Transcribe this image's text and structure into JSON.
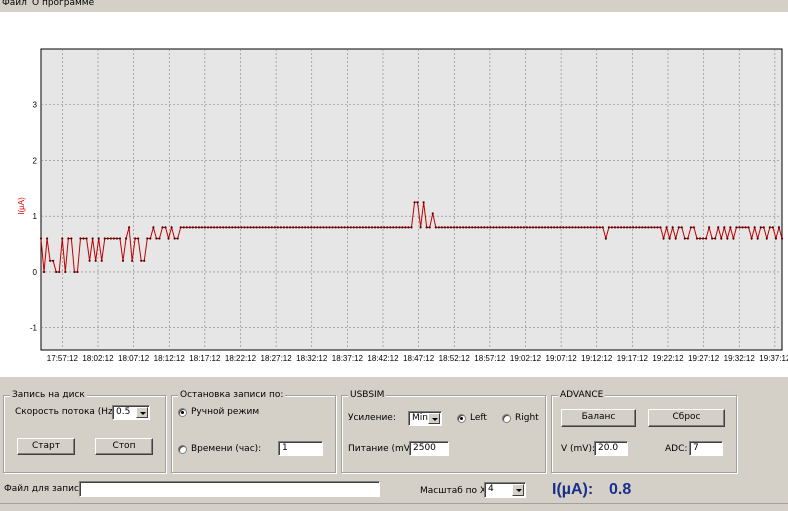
{
  "menu": {
    "file": "Файл",
    "about": "О программе"
  },
  "colors": {
    "trace": "#c00000",
    "marker": "#600000",
    "ylabel": "#e00000",
    "grid": "#808080",
    "readout": "#1a2f8c"
  },
  "chart_data": {
    "type": "line",
    "ylabel": "I(µA)",
    "ylim": [
      -1.4,
      4.0
    ],
    "yticks": [
      -1,
      0,
      1,
      2,
      3
    ],
    "xticks": [
      "17:57:12",
      "18:02:12",
      "18:07:12",
      "18:12:12",
      "18:17:12",
      "18:22:12",
      "18:27:12",
      "18:32:12",
      "18:37:12",
      "18:42:12",
      "18:47:12",
      "18:52:12",
      "18:57:12",
      "19:02:12",
      "19:07:12",
      "19:12:12",
      "19:17:12",
      "19:22:12",
      "19:27:12",
      "19:32:12",
      "19:37:12"
    ],
    "x_start": "17:54:12",
    "x_end": "19:38:12",
    "series": [
      {
        "values": [
          0.6,
          0.0,
          0.6,
          0.2,
          0.2,
          0.0,
          0.0,
          0.6,
          0.0,
          0.6,
          0.6,
          0.0,
          0.0,
          0.6,
          0.6,
          0.6,
          0.2,
          0.6,
          0.2,
          0.6,
          0.2,
          0.6,
          0.6,
          0.6,
          0.6,
          0.6,
          0.6,
          0.2,
          0.6,
          0.8,
          0.2,
          0.6,
          0.6,
          0.2,
          0.2,
          0.6,
          0.6,
          0.8,
          0.6,
          0.6,
          0.8,
          0.8,
          0.6,
          0.8,
          0.6,
          0.6,
          0.8,
          0.8,
          0.8,
          0.8,
          0.8,
          0.8,
          0.8,
          0.8,
          0.8,
          0.8,
          0.8,
          0.8,
          0.8,
          0.8,
          0.8,
          0.8,
          0.8,
          0.8,
          0.8,
          0.8,
          0.8,
          0.8,
          0.8,
          0.8,
          0.8,
          0.8,
          0.8,
          0.8,
          0.8,
          0.8,
          0.8,
          0.8,
          0.8,
          0.8,
          0.8,
          0.8,
          0.8,
          0.8,
          0.8,
          0.8,
          0.8,
          0.8,
          0.8,
          0.8,
          0.8,
          0.8,
          0.8,
          0.8,
          0.8,
          0.8,
          0.8,
          0.8,
          0.8,
          0.8,
          0.8,
          0.8,
          0.8,
          0.8,
          0.8,
          0.8,
          0.8,
          0.8,
          0.8,
          0.8,
          0.8,
          0.8,
          0.8,
          0.8,
          0.8,
          0.8,
          0.8,
          0.8,
          0.8,
          0.8,
          0.8,
          0.8,
          0.8,
          1.25,
          1.25,
          0.8,
          1.25,
          0.8,
          0.8,
          1.05,
          0.8,
          0.8,
          0.8,
          0.8,
          0.8,
          0.8,
          0.8,
          0.8,
          0.8,
          0.8,
          0.8,
          0.8,
          0.8,
          0.8,
          0.8,
          0.8,
          0.8,
          0.8,
          0.8,
          0.8,
          0.8,
          0.8,
          0.8,
          0.8,
          0.8,
          0.8,
          0.8,
          0.8,
          0.8,
          0.8,
          0.8,
          0.8,
          0.8,
          0.8,
          0.8,
          0.8,
          0.8,
          0.8,
          0.8,
          0.8,
          0.8,
          0.8,
          0.8,
          0.8,
          0.8,
          0.8,
          0.8,
          0.8,
          0.8,
          0.8,
          0.8,
          0.8,
          0.8,
          0.8,
          0.8,
          0.8,
          0.6,
          0.8,
          0.8,
          0.8,
          0.8,
          0.8,
          0.8,
          0.8,
          0.8,
          0.8,
          0.8,
          0.8,
          0.8,
          0.8,
          0.8,
          0.8,
          0.8,
          0.8,
          0.8,
          0.6,
          0.8,
          0.6,
          0.8,
          0.6,
          0.8,
          0.8,
          0.6,
          0.6,
          0.8,
          0.8,
          0.6,
          0.6,
          0.6,
          0.6,
          0.8,
          0.6,
          0.6,
          0.8,
          0.6,
          0.8,
          0.6,
          0.8,
          0.6,
          0.8,
          0.8,
          0.8,
          0.8,
          0.8,
          0.6,
          0.8,
          0.6,
          0.8,
          0.8,
          0.6,
          0.8,
          0.8,
          0.6,
          0.8,
          0.6
        ]
      }
    ]
  },
  "record_group": {
    "title": "Запись на диск",
    "rate_label": "Скорость потока (Hz):",
    "rate_value": "0.5",
    "start_button": "Старт",
    "stop_button": "Стоп"
  },
  "stop_group": {
    "title": "Остановка записи по:",
    "manual_label": "Ручной режим",
    "time_label": "Времени (час):",
    "time_value": "1"
  },
  "usbsim_group": {
    "title": "USBSIM",
    "gain_label": "Усиление:",
    "gain_value": "Min",
    "left_label": "Left",
    "right_label": "Right",
    "power_label": "Питание (mV):",
    "power_value": "2500"
  },
  "advance_group": {
    "title": "ADVANCE",
    "balance_button": "Баланс",
    "reset_button": "Сброс",
    "v_label": "V (mV):",
    "v_value": "20.0",
    "adc_label": "ADC:",
    "adc_value": "7"
  },
  "bottom": {
    "file_label": "Файл для записи:",
    "file_value": "",
    "scale_label": "Масштаб по X:",
    "scale_value": "4",
    "readout_label": "I(µA):",
    "readout_value": "0.8"
  }
}
